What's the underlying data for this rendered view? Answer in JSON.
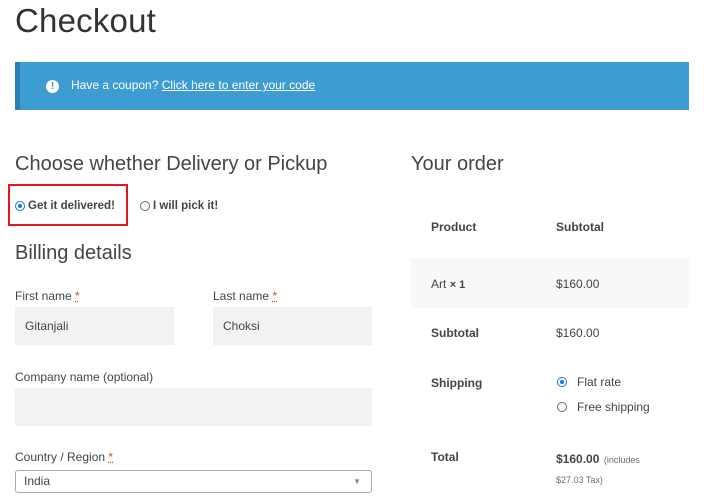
{
  "page_title": "Checkout",
  "coupon": {
    "icon": "info-icon",
    "prompt": "Have a coupon?",
    "link": "Click here to enter your code"
  },
  "delivery": {
    "heading": "Choose whether Delivery or Pickup",
    "options": [
      {
        "label": "Get it delivered!",
        "checked": true
      },
      {
        "label": "I will pick it!",
        "checked": false
      }
    ],
    "highlight_color": "#e0181b"
  },
  "billing": {
    "heading": "Billing details",
    "required_mark": "*",
    "first_name": {
      "label": "First name",
      "value": "Gitanjali"
    },
    "last_name": {
      "label": "Last name",
      "value": "Choksi"
    },
    "company": {
      "label": "Company name (optional)",
      "value": ""
    },
    "country": {
      "label": "Country / Region",
      "value": "India"
    }
  },
  "order": {
    "heading": "Your order",
    "col_product": "Product",
    "col_subtotal": "Subtotal",
    "item": {
      "name": "Art",
      "qty": "× 1",
      "price": "$160.00"
    },
    "subtotal_label": "Subtotal",
    "subtotal_value": "$160.00",
    "shipping_label": "Shipping",
    "shipping_options": [
      {
        "label": "Flat rate",
        "checked": true
      },
      {
        "label": "Free shipping",
        "checked": false
      }
    ],
    "total_label": "Total",
    "total_value": "$160.00",
    "total_note_1": "(includes",
    "total_note_2": "$27.03 Tax)"
  },
  "colors": {
    "accent": "#3d9cd2",
    "required": "#e2401c"
  }
}
